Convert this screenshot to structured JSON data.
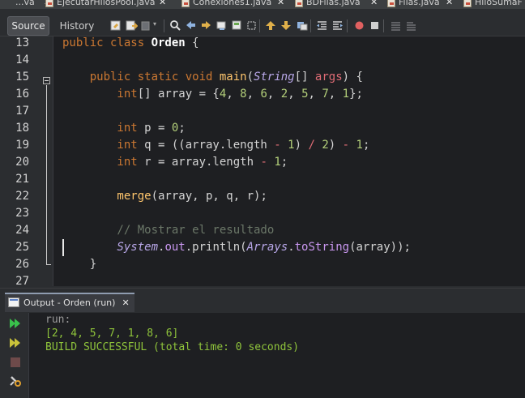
{
  "file_tabs": [
    {
      "label": "...va"
    },
    {
      "label": "EjecutarHilosPool.java"
    },
    {
      "label": "Conexiones1.java"
    },
    {
      "label": "BDFilas.java"
    },
    {
      "label": "Filas.java"
    },
    {
      "label": "HiloSumaF"
    }
  ],
  "toolbar": {
    "source_label": "Source",
    "history_label": "History",
    "icons": [
      "last-edit-icon",
      "back-icon",
      "forward-icon",
      "find-icon",
      "find-previous-icon",
      "find-next-icon",
      "find-selection-icon",
      "toggle-highlight-icon",
      "previous-bookmark-icon",
      "next-bookmark-icon",
      "toggle-bookmark-icon",
      "shift-left-icon",
      "shift-right-icon",
      "start-macro-icon",
      "stop-macro-icon",
      "comment-icon",
      "uncomment-icon"
    ]
  },
  "editor": {
    "line_numbers": [
      "13",
      "14",
      "15",
      "16",
      "17",
      "18",
      "19",
      "20",
      "21",
      "22",
      "23",
      "24",
      "25",
      "26",
      "27"
    ],
    "lines": [
      [
        {
          "t": "public class ",
          "c": "kw"
        },
        {
          "t": "Orden",
          "c": "cls"
        },
        {
          "t": " {",
          "c": "id"
        }
      ],
      [],
      [
        {
          "t": "    public static void ",
          "c": "kw"
        },
        {
          "t": "main",
          "c": "mth"
        },
        {
          "t": "(",
          "c": "id"
        },
        {
          "t": "String",
          "c": "it"
        },
        {
          "t": "[] ",
          "c": "id"
        },
        {
          "t": "args",
          "c": "op"
        },
        {
          "t": ") {",
          "c": "id"
        }
      ],
      [
        {
          "t": "        int",
          "c": "kw"
        },
        {
          "t": "[] array = {",
          "c": "id"
        },
        {
          "t": "4",
          "c": "num"
        },
        {
          "t": ", ",
          "c": "id"
        },
        {
          "t": "8",
          "c": "num"
        },
        {
          "t": ", ",
          "c": "id"
        },
        {
          "t": "6",
          "c": "num"
        },
        {
          "t": ", ",
          "c": "id"
        },
        {
          "t": "2",
          "c": "num"
        },
        {
          "t": ", ",
          "c": "id"
        },
        {
          "t": "5",
          "c": "num"
        },
        {
          "t": ", ",
          "c": "id"
        },
        {
          "t": "7",
          "c": "num"
        },
        {
          "t": ", ",
          "c": "id"
        },
        {
          "t": "1",
          "c": "num"
        },
        {
          "t": "};",
          "c": "id"
        }
      ],
      [],
      [
        {
          "t": "        int",
          "c": "kw"
        },
        {
          "t": " p = ",
          "c": "id"
        },
        {
          "t": "0",
          "c": "num"
        },
        {
          "t": ";",
          "c": "id"
        }
      ],
      [
        {
          "t": "        int",
          "c": "kw"
        },
        {
          "t": " q = ((array.length ",
          "c": "id"
        },
        {
          "t": "-",
          "c": "op"
        },
        {
          "t": " ",
          "c": "id"
        },
        {
          "t": "1",
          "c": "num"
        },
        {
          "t": ") ",
          "c": "id"
        },
        {
          "t": "/",
          "c": "op"
        },
        {
          "t": " ",
          "c": "id"
        },
        {
          "t": "2",
          "c": "num"
        },
        {
          "t": ") ",
          "c": "id"
        },
        {
          "t": "-",
          "c": "op"
        },
        {
          "t": " ",
          "c": "id"
        },
        {
          "t": "1",
          "c": "num"
        },
        {
          "t": ";",
          "c": "id"
        }
      ],
      [
        {
          "t": "        int",
          "c": "kw"
        },
        {
          "t": " r = array.length ",
          "c": "id"
        },
        {
          "t": "-",
          "c": "op"
        },
        {
          "t": " ",
          "c": "id"
        },
        {
          "t": "1",
          "c": "num"
        },
        {
          "t": ";",
          "c": "id"
        }
      ],
      [],
      [
        {
          "t": "        merge",
          "c": "mth"
        },
        {
          "t": "(array, p, q, r);",
          "c": "id"
        }
      ],
      [],
      [
        {
          "t": "        // Mostrar el resultado",
          "c": "cmt"
        }
      ],
      [
        {
          "t": "        System",
          "c": "it"
        },
        {
          "t": ".",
          "c": "id"
        },
        {
          "t": "out",
          "c": "fld"
        },
        {
          "t": ".println(",
          "c": "id"
        },
        {
          "t": "Arrays",
          "c": "it"
        },
        {
          "t": ".",
          "c": "id"
        },
        {
          "t": "toString",
          "c": "fld"
        },
        {
          "t": "(array));",
          "c": "id"
        }
      ],
      [
        {
          "t": "    }",
          "c": "id"
        }
      ],
      []
    ]
  },
  "output": {
    "tab_label": "Output - Orden (run)",
    "side_icons": [
      "rerun-icon",
      "rerun-with-options-icon",
      "stop-icon",
      "settings-icon"
    ],
    "lines": [
      "run:",
      "[2, 4, 5, 7, 1, 8, 6]",
      "BUILD SUCCESSFUL (total time: 0 seconds)"
    ]
  },
  "colors": {
    "background": "#1e1f22",
    "keyword": "#cc7832",
    "method": "#ffc66d",
    "number": "#b3cf7a",
    "comment": "#6b7768",
    "output_success": "#8fc43b"
  }
}
